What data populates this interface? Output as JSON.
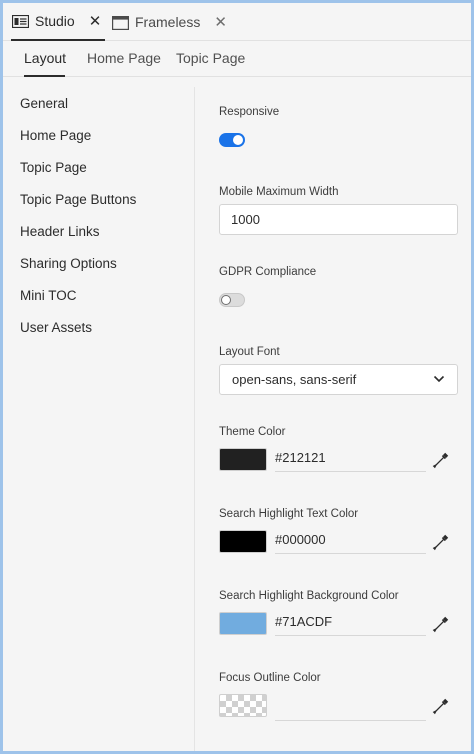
{
  "doc_tabs": [
    {
      "label": "Studio",
      "icon": "studio-panel-icon",
      "close": "✕"
    },
    {
      "label": "Frameless",
      "icon": "window-icon",
      "close": "✕"
    }
  ],
  "sub_tabs": [
    "Layout",
    "Home Page",
    "Topic Page"
  ],
  "sidebar": {
    "items": [
      {
        "label": "General"
      },
      {
        "label": "Home Page"
      },
      {
        "label": "Topic Page"
      },
      {
        "label": "Topic Page Buttons"
      },
      {
        "label": "Header Links"
      },
      {
        "label": "Sharing Options"
      },
      {
        "label": "Mini TOC"
      },
      {
        "label": "User Assets"
      }
    ]
  },
  "fields": {
    "responsive": {
      "label": "Responsive",
      "on": true
    },
    "mobile_max_width": {
      "label": "Mobile Maximum Width",
      "value": "1000"
    },
    "gdpr": {
      "label": "GDPR Compliance",
      "on": false
    },
    "layout_font": {
      "label": "Layout Font",
      "value": "open-sans, sans-serif"
    },
    "theme_color": {
      "label": "Theme Color",
      "value": "#212121",
      "swatch": "#212121"
    },
    "search_highlight_text": {
      "label": "Search Highlight Text Color",
      "value": "#000000",
      "swatch": "#000000"
    },
    "search_highlight_bg": {
      "label": "Search Highlight Background Color",
      "value": "#71ACDF",
      "swatch": "#71ACDF"
    },
    "focus_outline": {
      "label": "Focus Outline Color",
      "value": "",
      "swatch": "transparent"
    }
  },
  "colors": {
    "accent": "#1a73e8",
    "frame_border": "#9ec3ea"
  }
}
